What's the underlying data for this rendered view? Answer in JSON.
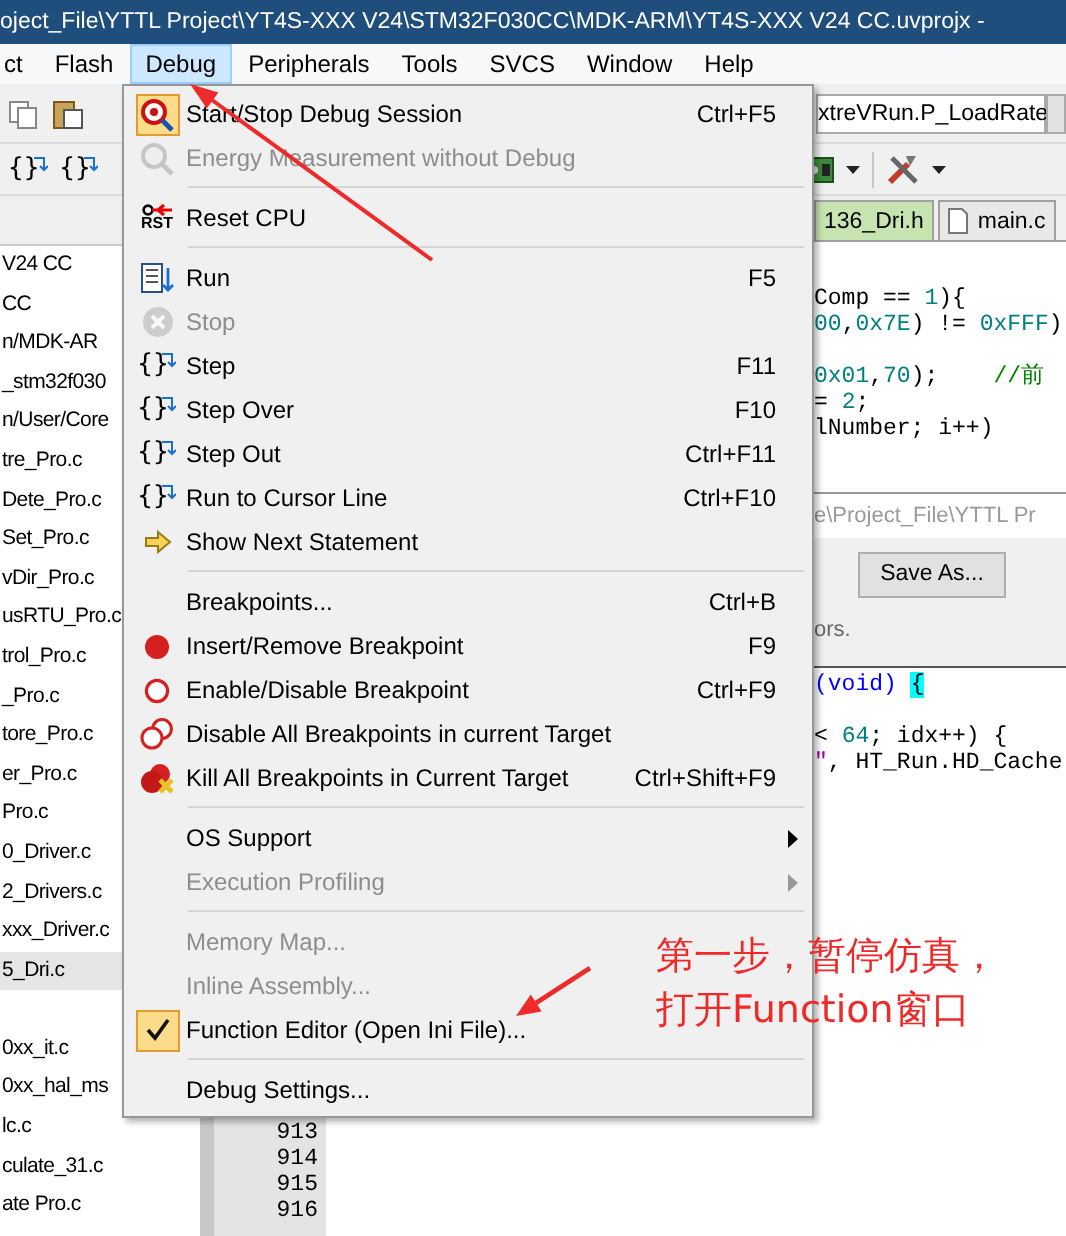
{
  "window": {
    "title": "oject_File\\YTTL Project\\YT4S-XXX V24\\STM32F030CC\\MDK-ARM\\YT4S-XXX V24 CC.uvprojx -"
  },
  "menubar": [
    {
      "label": "ct",
      "selected": false
    },
    {
      "label": "Flash",
      "selected": false
    },
    {
      "label": "Debug",
      "selected": true
    },
    {
      "label": "Peripherals",
      "selected": false
    },
    {
      "label": "Tools",
      "selected": false
    },
    {
      "label": "SVCS",
      "selected": false
    },
    {
      "label": "Window",
      "selected": false
    },
    {
      "label": "Help",
      "selected": false
    }
  ],
  "toolbar_1": {
    "target_field": "xtreVRun.P_LoadRate"
  },
  "toolbar_2": {
    "step_icons": [
      "{}",
      "{}"
    ]
  },
  "project_tree": [
    {
      "kind": "file",
      "label": "V24 CC",
      "selected": false
    },
    {
      "kind": "file",
      "label": "CC",
      "selected": false
    },
    {
      "kind": "file",
      "label": "n/MDK-AR",
      "selected": false
    },
    {
      "kind": "file",
      "label": "_stm32f030",
      "selected": false
    },
    {
      "kind": "file",
      "label": "n/User/Core",
      "selected": false
    },
    {
      "kind": "file",
      "label": "tre_Pro.c",
      "selected": false
    },
    {
      "kind": "file",
      "label": "Dete_Pro.c",
      "selected": false
    },
    {
      "kind": "file",
      "label": "Set_Pro.c",
      "selected": false
    },
    {
      "kind": "file",
      "label": "vDir_Pro.c",
      "selected": false
    },
    {
      "kind": "file",
      "label": "usRTU_Pro.c",
      "selected": false
    },
    {
      "kind": "file",
      "label": "trol_Pro.c",
      "selected": false
    },
    {
      "kind": "file",
      "label": "_Pro.c",
      "selected": false
    },
    {
      "kind": "file",
      "label": "tore_Pro.c",
      "selected": false
    },
    {
      "kind": "file",
      "label": "er_Pro.c",
      "selected": false
    },
    {
      "kind": "file",
      "label": "Pro.c",
      "selected": false
    },
    {
      "kind": "file",
      "label": "0_Driver.c",
      "selected": false
    },
    {
      "kind": "file",
      "label": "2_Drivers.c",
      "selected": false
    },
    {
      "kind": "file",
      "label": "xxx_Driver.c",
      "selected": false
    },
    {
      "kind": "file",
      "label": "5_Dri.c",
      "selected": true
    },
    {
      "kind": "blank"
    },
    {
      "kind": "file",
      "label": "0xx_it.c",
      "selected": false
    },
    {
      "kind": "file",
      "label": "0xx_hal_ms",
      "selected": false
    },
    {
      "kind": "file",
      "label": "lc.c",
      "selected": false
    },
    {
      "kind": "file",
      "label": "culate_31.c",
      "selected": false
    },
    {
      "kind": "file",
      "label": "ate Pro.c",
      "selected": false
    }
  ],
  "editor": {
    "tabs": [
      {
        "label": "136_Dri.h",
        "selected": true
      },
      {
        "label": "main.c",
        "selected": false
      }
    ],
    "code_top": [
      {
        "kind": "code",
        "segments": [
          {
            "kind": "plain",
            "text": "Comp == "
          },
          {
            "kind": "number",
            "text": "1"
          },
          {
            "kind": "plain",
            "text": "){"
          }
        ]
      },
      {
        "kind": "code",
        "segments": [
          {
            "kind": "number",
            "text": "00"
          },
          {
            "kind": "plain",
            "text": ","
          },
          {
            "kind": "number",
            "text": "0x7E"
          },
          {
            "kind": "plain",
            "text": ") != "
          },
          {
            "kind": "number",
            "text": "0xFFF"
          },
          {
            "kind": "plain",
            "text": ")"
          }
        ]
      },
      {
        "kind": "blank"
      },
      {
        "kind": "code",
        "segments": [
          {
            "kind": "number",
            "text": "0x01"
          },
          {
            "kind": "plain",
            "text": ","
          },
          {
            "kind": "number",
            "text": "70"
          },
          {
            "kind": "plain",
            "text": ");    "
          },
          {
            "kind": "comment",
            "text": "//前"
          }
        ]
      },
      {
        "kind": "code",
        "segments": [
          {
            "kind": "plain",
            "text": "= "
          },
          {
            "kind": "number",
            "text": "2"
          },
          {
            "kind": "plain",
            "text": ";"
          }
        ]
      },
      {
        "kind": "code",
        "segments": [
          {
            "kind": "plain",
            "text": "lNumber; i++)"
          }
        ]
      }
    ],
    "dialog": {
      "path": "e\\Project_File\\YTTL Pr",
      "button": "Save As...",
      "message": "ors."
    },
    "code_bottom": [
      {
        "kind": "code",
        "segments": [
          {
            "kind": "keyword",
            "text": "(void) "
          },
          {
            "kind": "match",
            "text": "{"
          }
        ]
      },
      {
        "kind": "blank"
      },
      {
        "kind": "code",
        "segments": [
          {
            "kind": "plain",
            "text": "< "
          },
          {
            "kind": "number",
            "text": "64"
          },
          {
            "kind": "plain",
            "text": "; idx++) {"
          }
        ]
      },
      {
        "kind": "code",
        "segments": [
          {
            "kind": "string",
            "text": "\""
          },
          {
            "kind": "plain",
            "text": ", HT_Run.HD_Cache"
          }
        ]
      }
    ],
    "line_numbers": [
      "913",
      "914",
      "915",
      "916"
    ]
  },
  "debug_menu": [
    {
      "kind": "item",
      "label": "Start/Stop Debug Session",
      "shortcut": "Ctrl+F5",
      "disabled": false,
      "checked": true,
      "submenu": false
    },
    {
      "kind": "item",
      "label": "Energy Measurement without Debug",
      "disabled": true,
      "checked": false,
      "submenu": false
    },
    {
      "kind": "separator"
    },
    {
      "kind": "item",
      "label": "Reset CPU",
      "icon_text": "RST",
      "disabled": false,
      "checked": false,
      "submenu": false
    },
    {
      "kind": "separator"
    },
    {
      "kind": "item",
      "label": "Run",
      "shortcut": "F5",
      "disabled": false,
      "checked": false,
      "submenu": false
    },
    {
      "kind": "item",
      "label": "Stop",
      "disabled": true,
      "checked": false,
      "submenu": false
    },
    {
      "kind": "item",
      "label": "Step",
      "shortcut": "F11",
      "icon_text": "{}",
      "disabled": false,
      "checked": false,
      "submenu": false
    },
    {
      "kind": "item",
      "label": "Step Over",
      "shortcut": "F10",
      "icon_text": "{}",
      "disabled": false,
      "checked": false,
      "submenu": false
    },
    {
      "kind": "item",
      "label": "Step Out",
      "shortcut": "Ctrl+F11",
      "icon_text": "{}",
      "disabled": false,
      "checked": false,
      "submenu": false
    },
    {
      "kind": "item",
      "label": "Run to Cursor Line",
      "shortcut": "Ctrl+F10",
      "icon_text": "{}",
      "disabled": false,
      "checked": false,
      "submenu": false
    },
    {
      "kind": "item",
      "label": "Show Next Statement",
      "disabled": false,
      "checked": false,
      "submenu": false
    },
    {
      "kind": "separator"
    },
    {
      "kind": "item",
      "label": "Breakpoints...",
      "shortcut": "Ctrl+B",
      "disabled": false,
      "checked": false,
      "submenu": false
    },
    {
      "kind": "item",
      "label": "Insert/Remove Breakpoint",
      "shortcut": "F9",
      "disabled": false,
      "checked": false,
      "submenu": false
    },
    {
      "kind": "item",
      "label": "Enable/Disable Breakpoint",
      "shortcut": "Ctrl+F9",
      "disabled": false,
      "checked": false,
      "submenu": false
    },
    {
      "kind": "item",
      "label": "Disable All Breakpoints in current Target",
      "disabled": false,
      "checked": false,
      "submenu": false
    },
    {
      "kind": "item",
      "label": "Kill All Breakpoints in Current Target",
      "shortcut": "Ctrl+Shift+F9",
      "disabled": false,
      "checked": false,
      "submenu": false
    },
    {
      "kind": "separator"
    },
    {
      "kind": "item",
      "label": "OS Support",
      "disabled": false,
      "checked": false,
      "submenu": true
    },
    {
      "kind": "item",
      "label": "Execution Profiling",
      "disabled": true,
      "checked": false,
      "submenu": true
    },
    {
      "kind": "separator"
    },
    {
      "kind": "item",
      "label": "Memory Map...",
      "disabled": true,
      "checked": false,
      "submenu": false
    },
    {
      "kind": "item",
      "label": "Inline Assembly...",
      "disabled": true,
      "checked": false,
      "submenu": false
    },
    {
      "kind": "item",
      "label": "Function Editor (Open Ini File)...",
      "disabled": false,
      "checked": true,
      "submenu": false
    },
    {
      "kind": "separator"
    },
    {
      "kind": "item",
      "label": "Debug Settings...",
      "disabled": false,
      "checked": false,
      "submenu": false
    }
  ],
  "annotation": {
    "lines": [
      "第一步，暂停仿真，",
      "打开Function窗口"
    ]
  }
}
